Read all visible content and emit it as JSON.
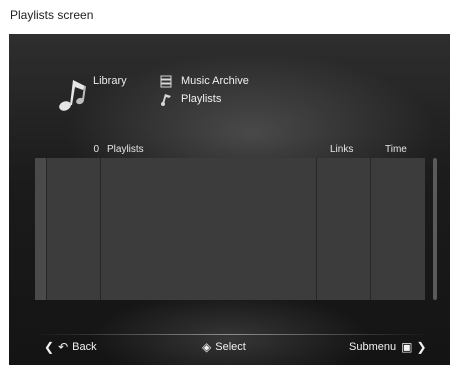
{
  "caption": "Playlists screen",
  "header": {
    "library_label": "Library",
    "items": [
      {
        "label": "Music Archive",
        "icon": "archive-icon"
      },
      {
        "label": "Playlists",
        "icon": "playlist-icon"
      }
    ]
  },
  "table": {
    "count": "0",
    "columns": {
      "name": "Playlists",
      "links": "Links",
      "time": "Time"
    },
    "row_count_visible": 13
  },
  "footer": {
    "back_label": "Back",
    "select_label": "Select",
    "submenu_label": "Submenu"
  }
}
